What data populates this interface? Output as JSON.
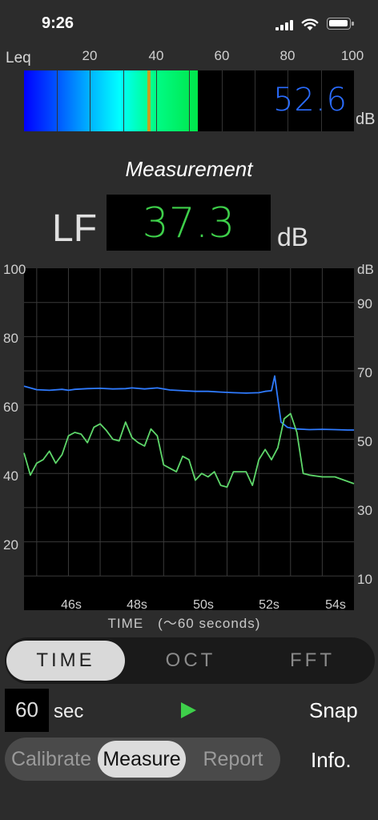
{
  "status": {
    "time": "9:26"
  },
  "meter": {
    "label": "Leq",
    "ticks": [
      "20",
      "40",
      "60",
      "80",
      "100"
    ],
    "value": "52.6",
    "unit": "dB",
    "level_percent": 52.6,
    "peak_percent": 37.3
  },
  "title": "Measurement",
  "reading": {
    "label": "LF",
    "value": "37.3",
    "unit": "dB"
  },
  "chart_data": {
    "type": "line",
    "y_left": {
      "ticks": [
        "100",
        "80",
        "60",
        "40",
        "20"
      ],
      "range": [
        0,
        100
      ]
    },
    "y_right": {
      "unit": "dB",
      "ticks": [
        "90",
        "70",
        "50",
        "30",
        "10"
      ]
    },
    "x_ticks": [
      "46s",
      "48s",
      "50s",
      "52s",
      "54s"
    ],
    "xlabel": "TIME　(～60 seconds)",
    "xlim": [
      44.6,
      55.0
    ],
    "grid": true,
    "series": [
      {
        "color": "#2f7bff",
        "x": [
          44.6,
          45.0,
          45.4,
          45.8,
          46.0,
          46.2,
          46.6,
          47.0,
          47.4,
          47.8,
          48.0,
          48.4,
          48.8,
          49.2,
          49.6,
          50.0,
          50.4,
          50.8,
          51.2,
          51.6,
          52.0,
          52.2,
          52.4,
          52.5,
          52.7,
          52.9,
          53.2,
          53.6,
          54.0,
          54.4,
          54.8,
          55.0
        ],
        "y": [
          65.5,
          64.5,
          64.3,
          64.6,
          64.3,
          64.6,
          64.8,
          64.9,
          64.7,
          64.8,
          65.0,
          64.7,
          65.0,
          64.4,
          64.2,
          64.0,
          64.0,
          63.8,
          63.6,
          63.5,
          63.6,
          64.0,
          64.2,
          68.5,
          55.0,
          53.5,
          53.0,
          52.8,
          52.9,
          52.8,
          52.7,
          52.7
        ]
      },
      {
        "color": "#5ed66a",
        "x": [
          44.6,
          44.8,
          45.0,
          45.2,
          45.4,
          45.6,
          45.8,
          46.0,
          46.2,
          46.4,
          46.6,
          46.8,
          47.0,
          47.2,
          47.4,
          47.6,
          47.8,
          48.0,
          48.2,
          48.4,
          48.6,
          48.8,
          49.0,
          49.2,
          49.4,
          49.6,
          49.8,
          50.0,
          50.2,
          50.4,
          50.6,
          50.8,
          51.0,
          51.2,
          51.4,
          51.6,
          51.8,
          52.0,
          52.2,
          52.4,
          52.6,
          52.8,
          53.0,
          53.2,
          53.4,
          53.6,
          54.0,
          54.4,
          55.0
        ],
        "y": [
          46.0,
          39.5,
          43.0,
          44.0,
          46.5,
          43.0,
          45.5,
          51.0,
          52.0,
          51.5,
          49.0,
          53.5,
          54.5,
          52.5,
          50.0,
          49.5,
          55.0,
          50.5,
          49.0,
          48.0,
          53.0,
          51.0,
          42.5,
          41.5,
          40.5,
          45.0,
          44.0,
          38.0,
          40.0,
          39.0,
          40.5,
          36.5,
          36.0,
          40.5,
          40.5,
          40.5,
          36.5,
          44.0,
          47.0,
          44.0,
          47.5,
          56.0,
          57.5,
          52.0,
          40.0,
          39.5,
          39.0,
          39.0,
          37.0
        ]
      }
    ]
  },
  "tabs": [
    {
      "label": "TIME",
      "active": true
    },
    {
      "label": "OCT",
      "active": false
    },
    {
      "label": "FFT",
      "active": false
    }
  ],
  "duration": {
    "value": "60",
    "unit": "sec"
  },
  "actions": {
    "snap": "Snap",
    "info": "Info."
  },
  "modes": [
    {
      "label": "Calibrate",
      "active": false
    },
    {
      "label": "Measure",
      "active": true
    },
    {
      "label": "Report",
      "active": false
    }
  ],
  "colors": {
    "accent_green": "#3ecf4a",
    "accent_blue": "#2a6cff"
  }
}
